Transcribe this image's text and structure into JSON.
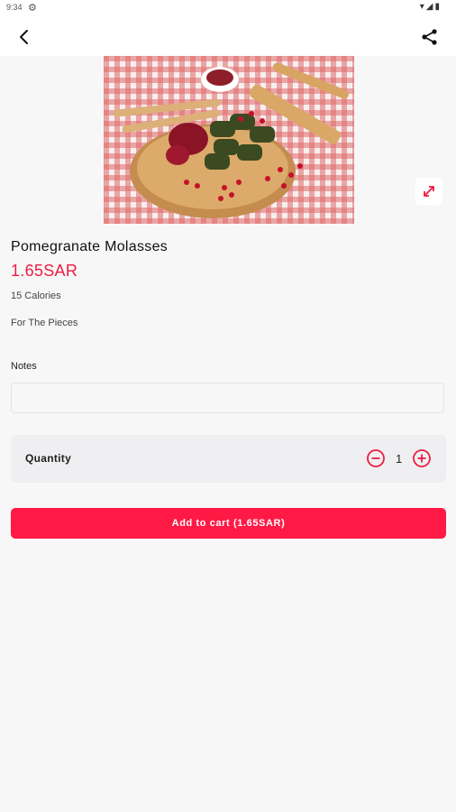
{
  "status_bar": {
    "time": "9:34"
  },
  "product": {
    "name": "Pomegranate Molasses",
    "price": "1.65SAR",
    "calories": "15 Calories",
    "description": "For The Pieces"
  },
  "notes": {
    "label": "Notes",
    "value": "",
    "placeholder": ""
  },
  "quantity": {
    "label": "Quantity",
    "value": "1"
  },
  "cart": {
    "button_label": "Add to cart (1.65SAR)"
  },
  "icons": {
    "back": "back-arrow-icon",
    "share": "share-icon",
    "expand": "expand-icon",
    "minus": "minus-circle-icon",
    "plus": "plus-circle-icon"
  },
  "colors": {
    "accent": "#ee1c43",
    "button": "#ff1a45",
    "background": "#f7f7f7",
    "card": "#efeff1"
  }
}
